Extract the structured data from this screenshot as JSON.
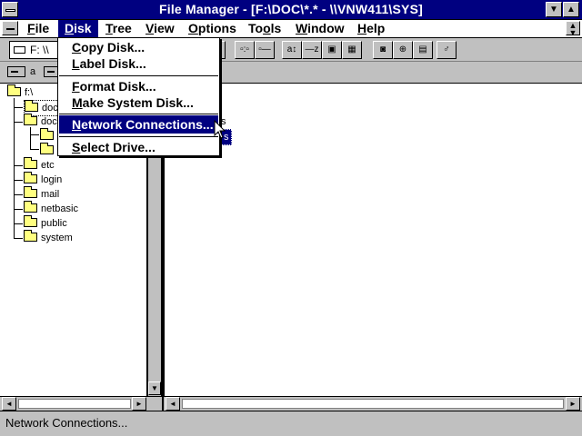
{
  "window": {
    "title": "File Manager - [F:\\DOC\\*.* - \\\\VNW411\\SYS]"
  },
  "menubar": {
    "items": [
      {
        "label": "File",
        "accel": "F",
        "rest": "ile"
      },
      {
        "label": "Disk",
        "accel": "D",
        "rest": "isk"
      },
      {
        "label": "Tree",
        "accel": "T",
        "rest": "ree"
      },
      {
        "label": "View",
        "accel": "V",
        "rest": "iew"
      },
      {
        "label": "Options",
        "accel": "O",
        "rest": "ptions"
      },
      {
        "label": "Tools",
        "accel": "T",
        "rest": "ools",
        "pre": ""
      },
      {
        "label": "Window",
        "accel": "W",
        "rest": "indow"
      },
      {
        "label": "Help",
        "accel": "H",
        "rest": "elp"
      }
    ]
  },
  "toolbar": {
    "drive_combo": "F: \\\\",
    "buttons": [
      "a-b-drive",
      "connect-net",
      "disconnect-net",
      "view-by-name",
      "view-all",
      "sort-name",
      "sort-type",
      "sort-size",
      "sort-date",
      "new-window",
      "print",
      "tools",
      "edit"
    ]
  },
  "drivebar": {
    "drive_a": "a"
  },
  "disk_menu": {
    "items": [
      {
        "pre": "",
        "accel": "C",
        "rest": "opy Disk..."
      },
      {
        "pre": "",
        "accel": "L",
        "rest": "abel Disk..."
      },
      {
        "pre": "",
        "accel": "F",
        "rest": "ormat Disk..."
      },
      {
        "pre": "",
        "accel": "M",
        "rest": "ake System Disk..."
      },
      {
        "pre": "",
        "accel": "N",
        "rest": "etwork Connections..."
      },
      {
        "pre": "",
        "accel": "S",
        "rest": "elect Drive..."
      }
    ],
    "highlighted": "Network Connections..."
  },
  "tree": {
    "root": "f:\\",
    "items": [
      "doc",
      "doc",
      "etc",
      "login",
      "mail",
      "netbasic",
      "public",
      "system"
    ]
  },
  "dir_pane": {
    "partial_items": [
      "s",
      "s"
    ]
  },
  "status": {
    "text": "Network Connections..."
  }
}
